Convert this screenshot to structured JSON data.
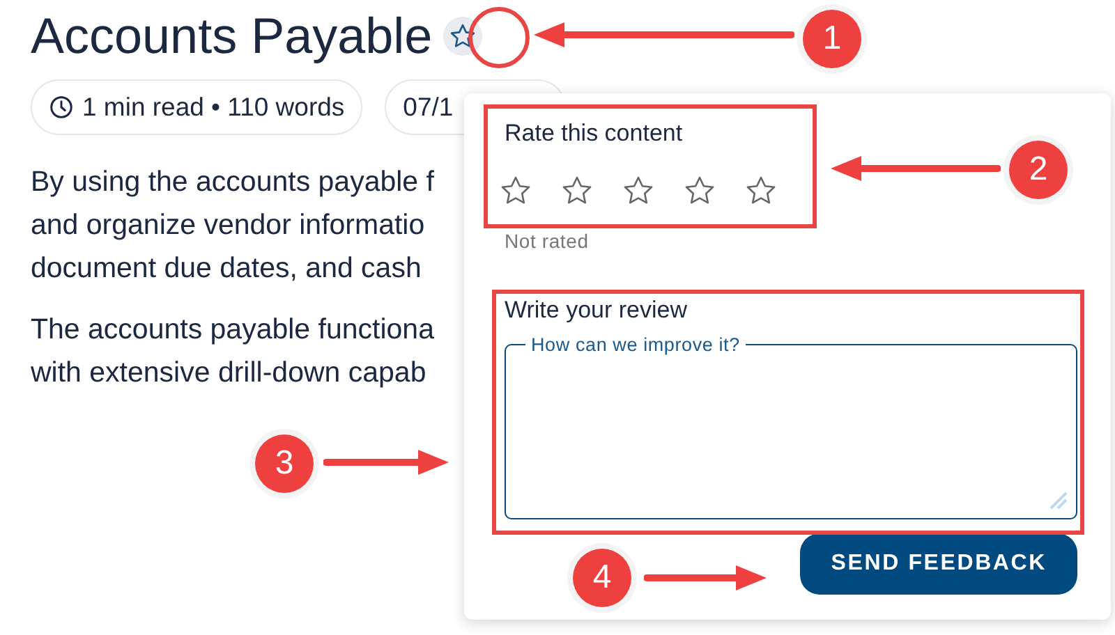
{
  "title": "Accounts Payable",
  "meta": [
    {
      "kind": "read",
      "text": "1 min read • 110 words"
    },
    {
      "kind": "date",
      "text": "07/1"
    }
  ],
  "paragraphs": [
    [
      "By using the accounts payable f",
      "and organize vendor informatio",
      "document due dates, and cash"
    ],
    [
      "The accounts payable functiona",
      "with extensive drill-down capab"
    ]
  ],
  "rating_popover": {
    "heading": "Rate this content",
    "stars": 0,
    "status": "Not rated",
    "review_label": "Write your review",
    "placeholder": "How can we improve it?",
    "button": "SEND FEEDBACK"
  },
  "callouts": [
    "1",
    "2",
    "3",
    "4"
  ]
}
